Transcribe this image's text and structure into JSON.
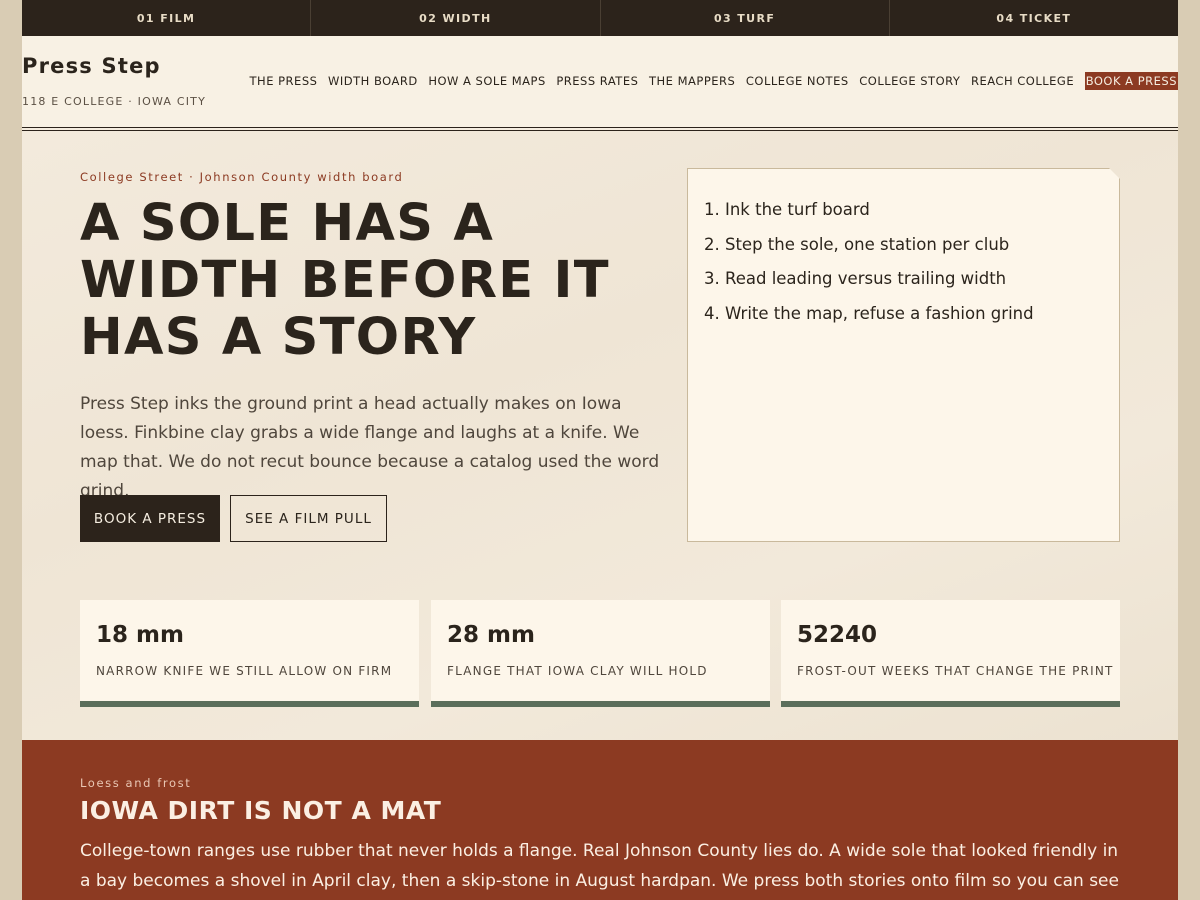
{
  "steps": [
    "01 FILM",
    "02 WIDTH",
    "03 TURF",
    "04 TICKET"
  ],
  "brand": {
    "name": "Press Step",
    "address": "118 E COLLEGE · IOWA CITY"
  },
  "nav": {
    "items": [
      "THE PRESS",
      "WIDTH BOARD",
      "HOW A SOLE MAPS",
      "PRESS RATES",
      "THE MAPPERS",
      "COLLEGE NOTES",
      "COLLEGE STORY",
      "REACH COLLEGE"
    ],
    "cta": "BOOK A PRESS",
    "cta_color": "#8c3a22"
  },
  "hero": {
    "eyebrow": "College Street · Johnson County width board",
    "headline": "A SOLE HAS A WIDTH BEFORE IT HAS A STORY",
    "lede": "Press Step inks the ground print a head actually makes on Iowa loess. Finkbine clay grabs a wide flange and laughs at a knife. We map that. We do not recut bounce because a catalog used the word grind.",
    "primary_button": "BOOK A PRESS",
    "secondary_button": "SEE A FILM PULL"
  },
  "process": [
    "1. Ink the turf board",
    "2. Step the sole, one station per club",
    "3. Read leading versus trailing width",
    "4. Write the map, refuse a fashion grind"
  ],
  "stats": [
    {
      "value": "18 mm",
      "label": "NARROW KNIFE WE STILL ALLOW ON FIRM"
    },
    {
      "value": "28 mm",
      "label": "FLANGE THAT IOWA CLAY WILL HOLD"
    },
    {
      "value": "52240",
      "label": "FROST-OUT WEEKS THAT CHANGE THE PRINT"
    }
  ],
  "section": {
    "eyebrow": "Loess and frost",
    "title": "IOWA DIRT IS NOT A MAT",
    "body": "College-town ranges use rubber that never holds a flange. Real Johnson County lies do. A wide sole that looked friendly in a bay becomes a shovel in April clay, then a skip-stone in August hardpan. We press both stories onto film so you can see the width"
  },
  "colors": {
    "dark": "#2c231b",
    "rust": "#8c3a22",
    "sage": "#5b6e5b",
    "cream": "#f5ede0"
  }
}
